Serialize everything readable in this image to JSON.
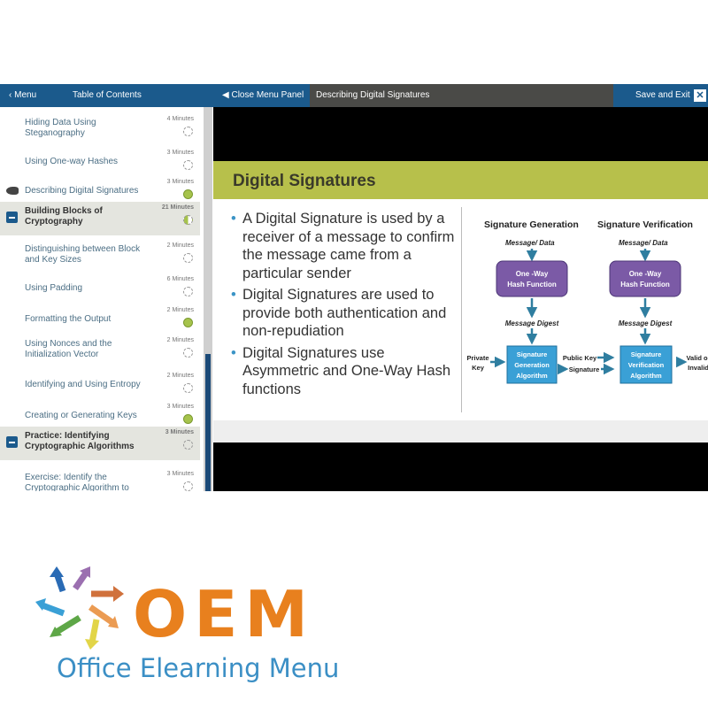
{
  "topbar": {
    "menu": "Menu",
    "toc": "Table of Contents",
    "close_panel": "Close Menu Panel",
    "current": "Describing Digital Signatures",
    "save_exit": "Save and Exit",
    "close": "✕"
  },
  "toc": [
    {
      "title": "Hiding Data Using Steganography",
      "minutes": "4 Minutes",
      "status": "empty"
    },
    {
      "title": "Using One-way Hashes",
      "minutes": "3 Minutes",
      "status": "empty"
    },
    {
      "title": "Describing Digital Signatures",
      "minutes": "3 Minutes",
      "status": "complete",
      "current": true
    },
    {
      "title": "Building Blocks of Cryptography",
      "minutes": "21 Minutes",
      "status": "partial",
      "section": true
    },
    {
      "title": "Distinguishing between Block and Key Sizes",
      "minutes": "2 Minutes",
      "status": "empty"
    },
    {
      "title": "Using Padding",
      "minutes": "6 Minutes",
      "status": "empty"
    },
    {
      "title": "Formatting the Output",
      "minutes": "2 Minutes",
      "status": "complete"
    },
    {
      "title": "Using Nonces and the Initialization Vector",
      "minutes": "2 Minutes",
      "status": "empty"
    },
    {
      "title": "Identifying and Using Entropy",
      "minutes": "2 Minutes",
      "status": "empty"
    },
    {
      "title": "Creating or Generating Keys",
      "minutes": "3 Minutes",
      "status": "complete"
    },
    {
      "title": "Practice: Identifying Cryptographic Algorithms",
      "minutes": "3 Minutes",
      "status": "empty",
      "section": true
    },
    {
      "title": "Exercise: Identify the Cryptographic Algorithm to",
      "minutes": "3 Minutes",
      "status": "empty"
    }
  ],
  "slide": {
    "title": "Digital Signatures",
    "bullets": [
      "A Digital Signature is used by a receiver of a message to confirm the message came from a particular sender",
      "Digital Signatures are used to provide both authentication and non-repudiation",
      "Digital Signatures use Asymmetric and One-Way Hash functions"
    ],
    "diagram": {
      "gen_title": "Signature Generation",
      "ver_title": "Signature Verification",
      "msg": "Message/ Data",
      "hash1": "One -Way",
      "hash2": "Hash Function",
      "digest": "Message Digest",
      "private1": "Private",
      "private2": "Key",
      "gen1": "Signature",
      "gen2": "Generation",
      "gen3": "Algorithm",
      "public_key": "Public Key",
      "signature": "Signature",
      "ver1": "Signature",
      "ver2": "Verification",
      "ver3": "Algorithm",
      "valid1": "Valid or",
      "valid2": "Invalid"
    }
  },
  "logo": {
    "mark": "OEM",
    "name": "Office Elearning Menu"
  },
  "colors": {
    "nav": "#1b5a8c",
    "accent": "#b7c04b",
    "complete": "#a6c34c",
    "logo_orange": "#e8801e",
    "logo_blue": "#3b8fc5"
  }
}
